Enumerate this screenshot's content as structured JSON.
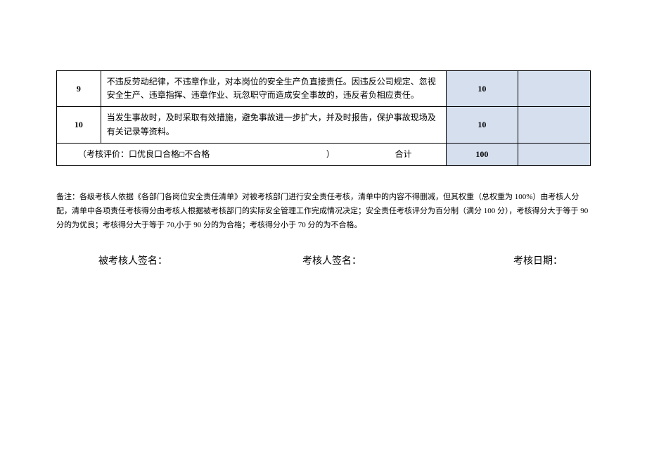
{
  "table": {
    "rows": [
      {
        "num": "9",
        "desc": "不违反劳动纪律，不违章作业，对本岗位的安全生产负直接责任。因违反公司规定、忽视安全生产、违章指挥、违章作业、玩忽职守而造成安全事故的，违反者负相应责任。",
        "score": "10",
        "blank": ""
      },
      {
        "num": "10",
        "desc": "当发生事故时，及时采取有效措施，避免事故进一步扩大，并及时报告，保护事故现场及有关记录等资料。",
        "score": "10",
        "blank": ""
      }
    ],
    "summary": {
      "left": "（考核评价：口优良口合格□不合格",
      "paren": "）",
      "right": "合计",
      "total": "100",
      "blank": ""
    }
  },
  "notes": "备注：各级考核人依据《各部门各岗位安全责任清单》对被考核部门进行安全责任考核，清单中的内容不得删减，但其权重（总权重为 100%）由考核人分配，清单中各项责任考核得分由考核人根据被考核部门的实际安全管理工作完成情况决定；安全责任考核评分为百分制（满分 100 分），考核得分大于等于 90 分的为优良；考核得分大于等于 70,小于 90 分的为合格；考核得分小于 70 分的为不合格。",
  "signatures": {
    "assessee": "被考核人签名：",
    "assessor": "考核人签名：",
    "date": "考核日期："
  }
}
